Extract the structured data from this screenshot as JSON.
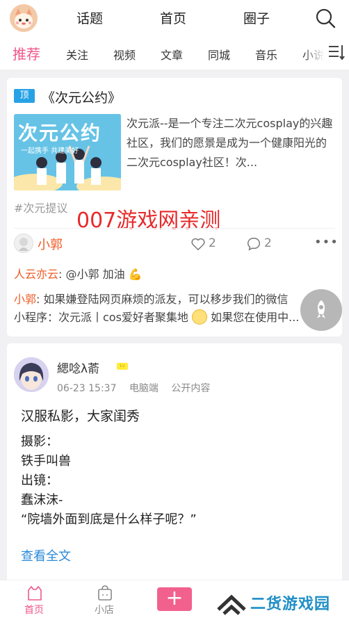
{
  "header": {
    "nav": [
      "话题",
      "首页",
      "圈子"
    ]
  },
  "tabs": [
    "推荐",
    "关注",
    "视频",
    "文章",
    "同城",
    "音乐",
    "小说"
  ],
  "pinned_post": {
    "badge": "顶",
    "title": "《次元公约》",
    "thumb_title": "次元公约",
    "thumb_sub": "一起携手 共建美好",
    "excerpt": "次元派--是一个专注二次元cosplay的兴趣社区，我们的愿景是成为一个健康阳光的二次元cosplay社区！次...",
    "hashtag": "#次元提议",
    "watermark": "007游戏网亲测",
    "author": "小郭",
    "likes": "2",
    "comments": "2",
    "more": "•••",
    "comment_list": [
      {
        "author": "人云亦云",
        "text": ": @小郭 加油",
        "emoji": "💪"
      },
      {
        "author": "小郭",
        "text": ": 如果嫌登陆网页麻烦的派友，可以移步我们的微信"
      },
      {
        "author": "",
        "text": "小程序：次元派丨cos爱好者聚集地",
        "text2": " 如果您在使用中..."
      }
    ]
  },
  "post2": {
    "author": "緦唸λ萮",
    "level": "Lv",
    "date": "06-23 15:37",
    "device": "电脑端",
    "visibility": "公开内容",
    "title": "汉服私影，大家闺秀",
    "body": [
      "摄影：",
      "铁手叫兽",
      "出镜：",
      "蠢沫沫-",
      "“院墙外面到底是什么样子呢？”"
    ],
    "read_more": "查看全文"
  },
  "bottom_nav": {
    "home": "首页",
    "shop": "小店",
    "add": "+",
    "brand": "二货游戏园"
  },
  "colors": {
    "accent_pink": "#f0568a",
    "badge_blue": "#27a2e6",
    "author_orange": "#f05a24",
    "link_blue": "#2b8ad8",
    "watermark_red": "#e8292a",
    "brand_blue": "#1f8ec5"
  }
}
